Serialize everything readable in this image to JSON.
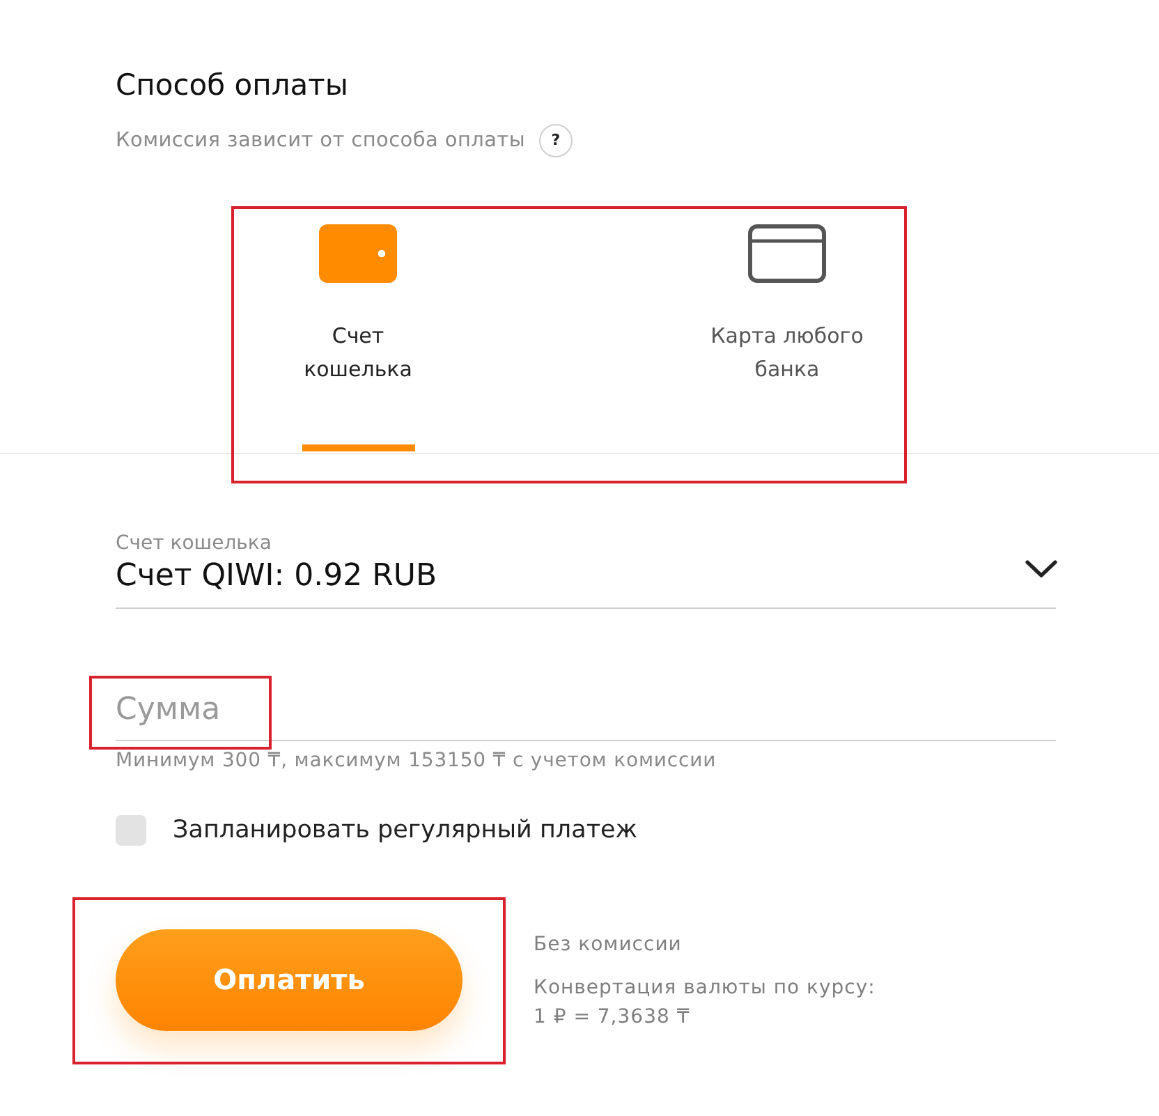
{
  "heading": {
    "title": "Способ оплаты",
    "subtitle": "Комиссия зависит от способа оплаты",
    "help": "?"
  },
  "payment_methods": {
    "highlighted": true,
    "tabs": [
      {
        "kind": "wallet",
        "label": "Счет кошелька",
        "selected": true
      },
      {
        "kind": "card",
        "label": "Карта любого банка",
        "selected": false
      }
    ]
  },
  "wallet_select": {
    "label": "Счет кошелька",
    "value": "Счет QIWI: 0.92 RUB"
  },
  "amount_field": {
    "placeholder": "Сумма",
    "highlighted": true,
    "hint": "Минимум 300 ₸, максимум 153150 ₸ с учетом комиссии"
  },
  "recurring": {
    "label": "Запланировать регулярный платеж",
    "checked": false
  },
  "pay_button": {
    "label": "Оплатить",
    "highlighted": true
  },
  "fee_info": [
    "Без комиссии",
    "Конвертация валюты по курсу:",
    "1 ₽ = 7,3638 ₸"
  ]
}
